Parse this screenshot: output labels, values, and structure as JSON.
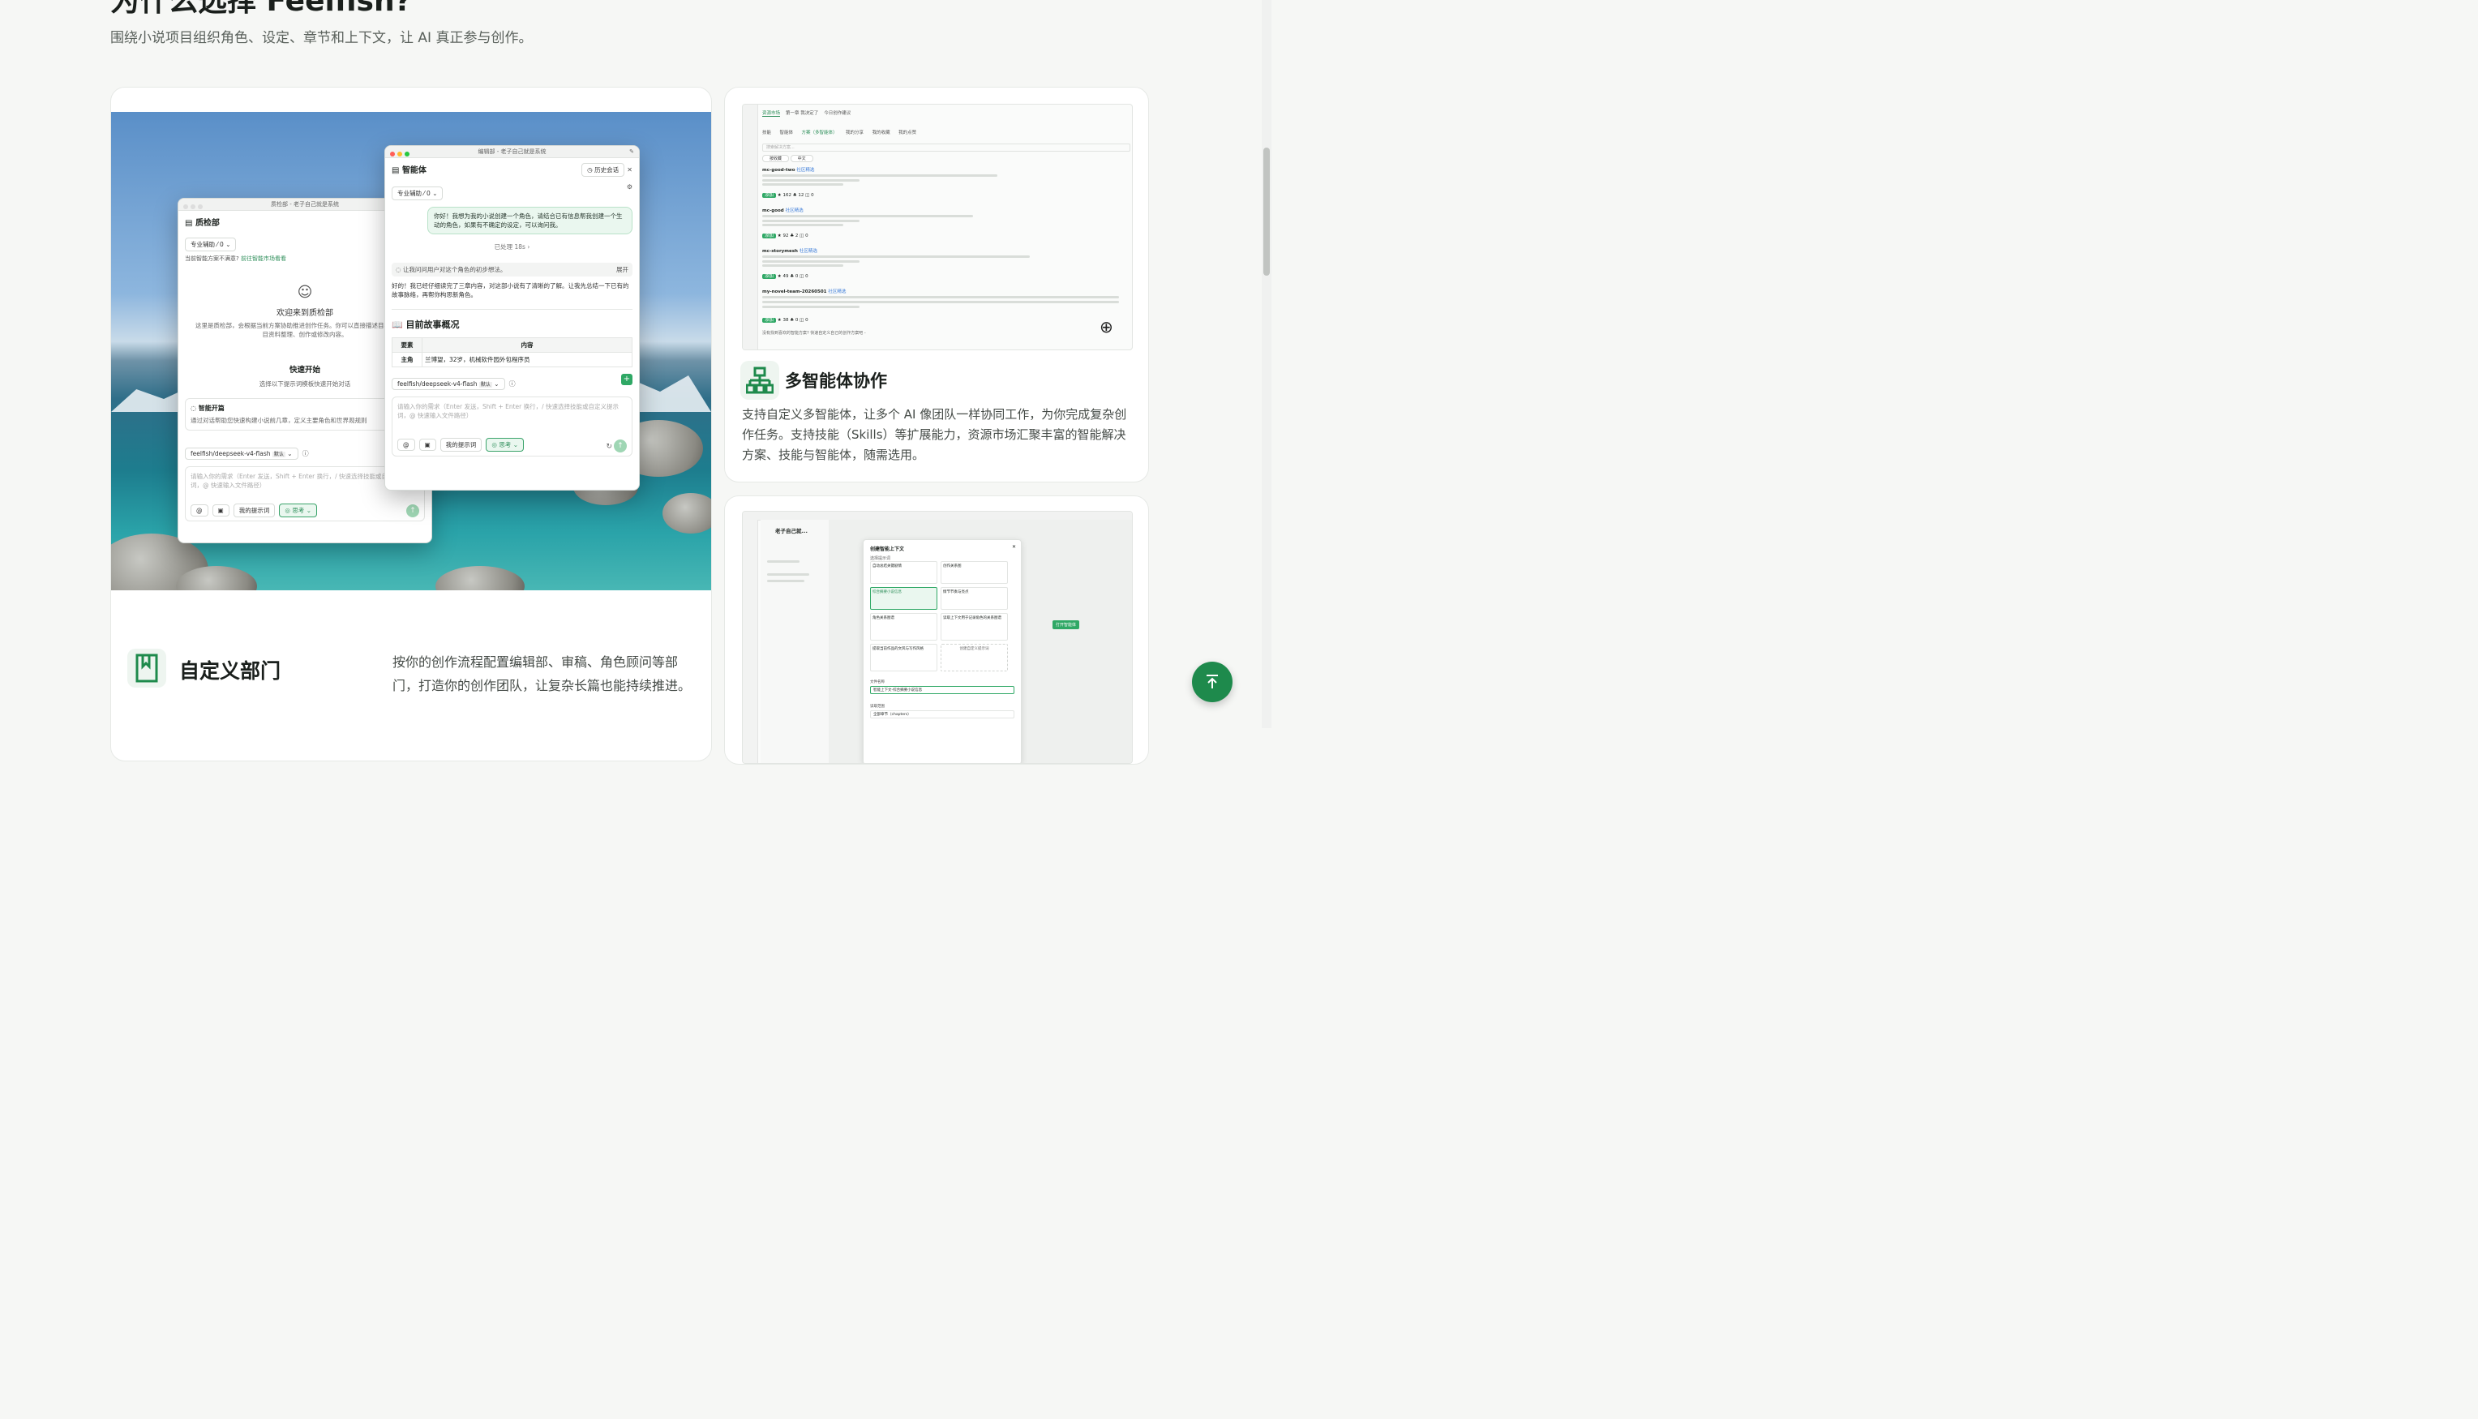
{
  "section": {
    "heading_visible_part": "为什么选择 Feelfish?",
    "subtitle": "围绕小说项目组织角色、设定、章节和上下文，让 AI 真正参与创作。"
  },
  "features": [
    {
      "title": "自定义部门",
      "icon": "bookmark-icon",
      "description": "按你的创作流程配置编辑部、审稿、角色顾问等部门，打造你的创作团队，让复杂长篇也能持续推进。"
    },
    {
      "title": "多智能体协作",
      "icon": "org-chart-icon",
      "description": "支持自定义多智能体，让多个 AI 像团队一样协同工作，为你完成复杂创作任务。支持技能（Skills）等扩展能力，资源市场汇聚丰富的智能解决方案、技能与智能体，随需选用。"
    }
  ],
  "mock_left_window": {
    "title": "质检部 - 老子自己就是系统",
    "panel_title": "质检部",
    "history_stub": "历",
    "mode_select": "专业辅助",
    "mode_count": "0",
    "hint": "当前智能方案不满意?",
    "hint_link": "前往智能市场看看",
    "welcome_title": "欢迎来到质检部",
    "welcome_desc": "这里是质检部，会根据当前方案协助推进创作任务。你可以直接描述目标，或从项目资料整理、创作或修改内容。",
    "quick_start": "快速开始",
    "quick_start_desc": "选择以下提示词模板快速开始对话",
    "prompt_card_title": "智能开篇",
    "prompt_card_desc": "通过对话帮助您快速构建小说前几章，定义主要角色和世界观规则",
    "model": "feelfish/deepseek-v4-flash",
    "model_badge": "默认",
    "input_placeholder": "请输入你的需求（Enter 发送，Shift + Enter 换行，/ 快速选择技能或自定义提示词，@ 快速输入文件路径）",
    "my_prompts": "我的提示词",
    "think": "思考"
  },
  "mock_right_window": {
    "title": "编辑部 - 老子自己就是系统",
    "panel_title": "智能体",
    "history": "历史会话",
    "mode_select": "专业辅助",
    "mode_count": "0",
    "user_message": "你好！我想为我的小说创建一个角色，请结合已有信息帮我创建一个生动的角色，如果有不确定的设定，可以询问我。",
    "processed": "已处理 18s",
    "tool_note": "让我问问用户对这个角色的初步想法。",
    "expand": "展开",
    "assistant_reply": "好的！我已经仔细读完了三章内容，对这部小说有了清晰的了解。让我先总结一下已有的故事脉络，再帮你构思新角色。",
    "section_heading": "目前故事概况",
    "table_headers": [
      "要素",
      "内容"
    ],
    "table_rows": [
      [
        "主角",
        "兰博望，32岁，机械软件园外包程序员"
      ]
    ],
    "model": "feelfish/deepseek-v4-flash",
    "model_badge": "默认",
    "input_placeholder": "请输入你的需求（Enter 发送，Shift + Enter 换行，/ 快速选择技能或自定义提示词，@ 快速输入文件路径）",
    "my_prompts": "我的提示词",
    "think": "思考"
  },
  "market_screenshot": {
    "tabs": [
      "资源市场",
      "第一章 我决定了",
      "今日创作建议"
    ],
    "filters": [
      "技能",
      "智能体",
      "方案（多智能体）",
      "我的分享",
      "我的收藏",
      "我的点赞"
    ],
    "search_placeholder": "搜索解决方案...",
    "sort": "按收藏",
    "lang": "中文",
    "items": [
      {
        "name": "mc-good-two",
        "tag": "社区精选",
        "likes": "162",
        "stars": "12",
        "comments": "0"
      },
      {
        "name": "mc-good",
        "tag": "社区精选",
        "likes": "92",
        "stars": "2",
        "comments": "0"
      },
      {
        "name": "mc-storymesh",
        "tag": "社区精选",
        "likes": "49",
        "stars": "0",
        "comments": "0"
      },
      {
        "name": "my-novel-team-20260501",
        "tag": "社区精选",
        "likes": "38",
        "stars": "0",
        "comments": "0"
      }
    ],
    "add_label": "添加",
    "footer_hint": "没有找到喜欢的智能方案? 快速自定义自己的创作方案吧 -"
  },
  "context_screenshot": {
    "project": "老子自己就...",
    "dialog_title": "创建智能上下文",
    "dialog_subtitle": "选择提示词",
    "options": [
      "自动总结关键剧情",
      "创作关系图",
      "综合摘要小说信息",
      "情节节奏与亮点",
      "角色关系图谱",
      "读取上下文用于记录角色的关系图谱",
      "提取当前作品的文风与写作风格",
      "创建自定义提示词"
    ],
    "file_label": "文件名称",
    "file_value": "智能上下文-综合摘要小说信息",
    "range_label": "读取范围",
    "range_value": "全部章节（chapters）",
    "open_button": "打开智能体"
  },
  "colors": {
    "accent": "#1e8a4c",
    "accent_light": "#eaf7ef",
    "background": "#f6f7f5"
  },
  "floating": {
    "back_to_top_icon": "arrow-up-icon"
  }
}
